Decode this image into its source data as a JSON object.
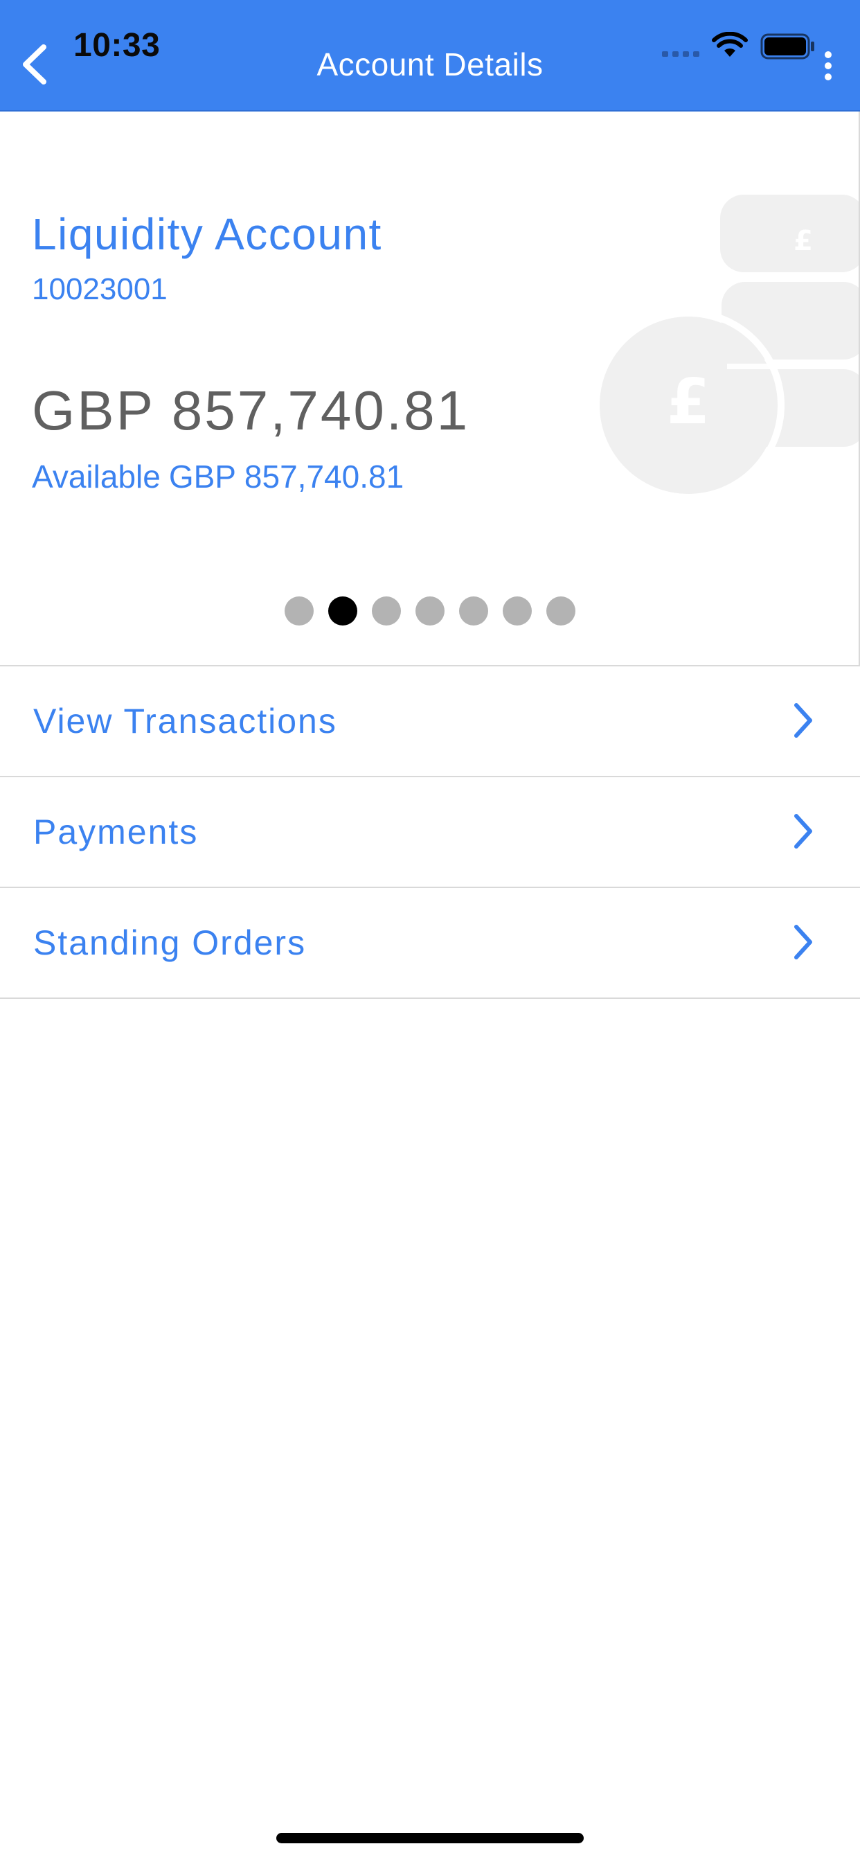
{
  "status_bar": {
    "time": "10:33"
  },
  "header": {
    "title": "Account Details",
    "back_icon": "chevron-left-icon",
    "more_icon": "vertical-dots-icon"
  },
  "account": {
    "name": "Liquidity Account",
    "number": "10023001",
    "balance": "GBP 857,740.81",
    "available_label": "Available",
    "available_amount": "GBP 857,740.81",
    "decorative_icon": "pound-coins-icon"
  },
  "pager": {
    "total": 7,
    "active_index": 1
  },
  "menu": [
    {
      "label": "View Transactions",
      "icon": "chevron-right-icon"
    },
    {
      "label": "Payments",
      "icon": "chevron-right-icon"
    },
    {
      "label": "Standing Orders",
      "icon": "chevron-right-icon"
    }
  ],
  "colors": {
    "accent": "#3b82f0",
    "balance_text": "#606060",
    "divider": "#d9d9d9",
    "dot_inactive": "#b3b3b3",
    "dot_active": "#000000"
  }
}
